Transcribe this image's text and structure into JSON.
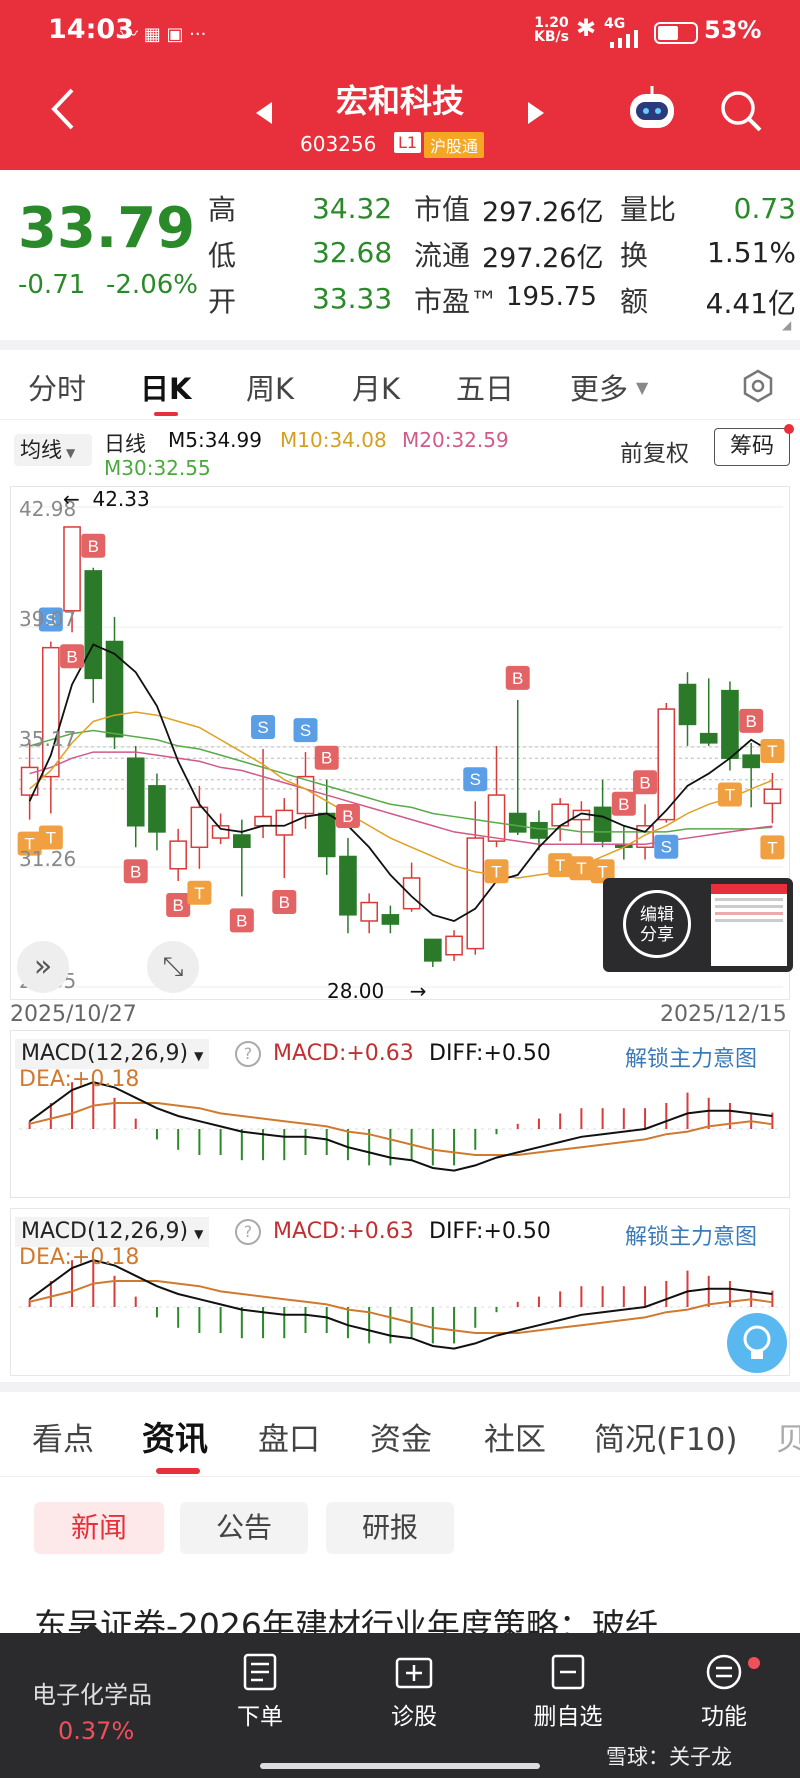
{
  "status_bar": {
    "time": "14:03",
    "speed_top": "1.20",
    "speed_bottom": "KB/s",
    "network": "4G",
    "battery": "53%"
  },
  "header": {
    "title": "宏和科技",
    "code": "603256",
    "level_badge": "L1",
    "exchange_badge": "沪股通"
  },
  "quote": {
    "price": "33.79",
    "change": "-0.71",
    "change_pct": "-2.06%",
    "rows": [
      [
        {
          "label": "高",
          "value": "34.32"
        },
        {
          "label": "市值",
          "value": "297.26亿"
        },
        {
          "label": "量比",
          "value": "0.73"
        }
      ],
      [
        {
          "label": "低",
          "value": "32.68"
        },
        {
          "label": "流通",
          "value": "297.26亿"
        },
        {
          "label": "换",
          "value": "1.51%"
        }
      ],
      [
        {
          "label": "开",
          "value": "33.33"
        },
        {
          "label": "市盈™",
          "value": "195.75"
        },
        {
          "label": "额",
          "value": "4.41亿"
        }
      ]
    ]
  },
  "chart_tabs": [
    "分时",
    "日K",
    "周K",
    "月K",
    "五日",
    "更多"
  ],
  "active_chart_tab": "日K",
  "ma_bar": {
    "select": "均线",
    "period": "日线",
    "m5": "M5:34.99",
    "m10": "M10:34.08",
    "m20": "M20:32.59",
    "m30": "M30:32.55",
    "adjust": "前复权",
    "chips_button": "筹码"
  },
  "kline_labels": {
    "y_ticks": [
      "42.98",
      "39.07",
      "35.17",
      "31.26",
      "27.35"
    ],
    "max_note": "42.33",
    "min_note": "28.00",
    "date_start": "2025/10/27",
    "date_end": "2025/12/15",
    "share_popup": [
      "编辑",
      "分享"
    ]
  },
  "chart_data": {
    "type": "candlestick",
    "ylim": [
      27.35,
      42.98
    ],
    "candles": [
      {
        "o": 33.6,
        "c": 34.5,
        "h": 35.4,
        "l": 32.8
      },
      {
        "o": 34.2,
        "c": 38.4,
        "h": 38.6,
        "l": 33.0
      },
      {
        "o": 39.6,
        "c": 42.33,
        "h": 42.33,
        "l": 38.9
      },
      {
        "o": 40.9,
        "c": 37.4,
        "h": 41.0,
        "l": 36.6
      },
      {
        "o": 38.6,
        "c": 35.5,
        "h": 39.4,
        "l": 35.1
      },
      {
        "o": 34.8,
        "c": 32.6,
        "h": 35.2,
        "l": 31.9
      },
      {
        "o": 33.9,
        "c": 32.4,
        "h": 34.3,
        "l": 31.8
      },
      {
        "o": 31.2,
        "c": 32.1,
        "h": 32.5,
        "l": 30.8
      },
      {
        "o": 31.9,
        "c": 33.2,
        "h": 33.9,
        "l": 31.2
      },
      {
        "o": 32.2,
        "c": 32.6,
        "h": 33.0,
        "l": 32.0
      },
      {
        "o": 32.3,
        "c": 31.9,
        "h": 32.8,
        "l": 30.3
      },
      {
        "o": 32.6,
        "c": 32.9,
        "h": 35.1,
        "l": 32.2
      },
      {
        "o": 32.3,
        "c": 33.1,
        "h": 33.5,
        "l": 30.9
      },
      {
        "o": 33.0,
        "c": 34.2,
        "h": 35.0,
        "l": 32.5
      },
      {
        "o": 33.0,
        "c": 31.6,
        "h": 34.1,
        "l": 31.0
      },
      {
        "o": 31.6,
        "c": 29.7,
        "h": 32.2,
        "l": 29.1
      },
      {
        "o": 29.5,
        "c": 30.1,
        "h": 30.4,
        "l": 29.1
      },
      {
        "o": 29.7,
        "c": 29.4,
        "h": 30.0,
        "l": 29.1
      },
      {
        "o": 29.9,
        "c": 30.9,
        "h": 31.4,
        "l": 29.8
      },
      {
        "o": 28.9,
        "c": 28.2,
        "h": 28.9,
        "l": 28.0
      },
      {
        "o": 28.4,
        "c": 29.0,
        "h": 29.2,
        "l": 28.2
      },
      {
        "o": 28.6,
        "c": 32.2,
        "h": 33.4,
        "l": 28.4
      },
      {
        "o": 32.1,
        "c": 33.6,
        "h": 35.2,
        "l": 31.9
      },
      {
        "o": 33.0,
        "c": 32.4,
        "h": 36.7,
        "l": 32.3
      },
      {
        "o": 32.7,
        "c": 32.2,
        "h": 33.1,
        "l": 31.8
      },
      {
        "o": 32.6,
        "c": 33.3,
        "h": 33.5,
        "l": 32.1
      },
      {
        "o": 32.8,
        "c": 33.1,
        "h": 33.4,
        "l": 32.0
      },
      {
        "o": 33.2,
        "c": 32.1,
        "h": 34.1,
        "l": 31.9
      },
      {
        "o": 32.0,
        "c": 31.9,
        "h": 32.6,
        "l": 31.5
      },
      {
        "o": 31.9,
        "c": 32.6,
        "h": 33.3,
        "l": 31.5
      },
      {
        "o": 32.8,
        "c": 36.4,
        "h": 36.6,
        "l": 32.7
      },
      {
        "o": 37.2,
        "c": 35.9,
        "h": 37.6,
        "l": 35.2
      },
      {
        "o": 35.6,
        "c": 35.3,
        "h": 37.4,
        "l": 35.2
      },
      {
        "o": 37.0,
        "c": 34.8,
        "h": 37.3,
        "l": 34.4
      },
      {
        "o": 34.9,
        "c": 34.5,
        "h": 35.3,
        "l": 33.2
      },
      {
        "o": 33.33,
        "c": 33.79,
        "h": 34.32,
        "l": 32.68
      }
    ],
    "ma5": [
      33.4,
      34.9,
      37.2,
      38.5,
      38.2,
      37.6,
      36.5,
      34.7,
      33.3,
      32.5,
      32.4,
      32.6,
      32.6,
      32.9,
      33.0,
      32.6,
      31.9,
      31.0,
      30.3,
      29.7,
      29.5,
      29.9,
      30.8,
      31.0,
      31.9,
      32.6,
      33.0,
      32.9,
      32.6,
      32.4,
      33.1,
      33.9,
      34.3,
      34.8,
      35.4,
      34.99
    ],
    "ma10": [
      33.8,
      34.4,
      35.3,
      36.0,
      36.2,
      36.3,
      36.2,
      36.0,
      35.8,
      35.4,
      35.0,
      34.6,
      34.1,
      33.8,
      33.4,
      33.0,
      32.6,
      32.2,
      31.9,
      31.6,
      31.3,
      31.1,
      31.0,
      30.9,
      31.0,
      31.1,
      31.3,
      31.6,
      31.9,
      32.3,
      32.6,
      33.0,
      33.3,
      33.5,
      33.8,
      34.08
    ],
    "ma20": [
      34.3,
      34.5,
      34.8,
      35.0,
      35.0,
      35.0,
      34.9,
      34.8,
      34.7,
      34.5,
      34.4,
      34.2,
      34.0,
      33.8,
      33.6,
      33.4,
      33.2,
      33.0,
      32.8,
      32.6,
      32.4,
      32.3,
      32.2,
      32.1,
      32.0,
      32.0,
      32.0,
      32.0,
      32.0,
      32.0,
      32.1,
      32.2,
      32.3,
      32.4,
      32.5,
      32.59
    ],
    "ma30": [
      35.2,
      35.4,
      35.6,
      35.7,
      35.6,
      35.5,
      35.4,
      35.2,
      35.1,
      34.9,
      34.7,
      34.5,
      34.3,
      34.1,
      33.9,
      33.7,
      33.5,
      33.3,
      33.2,
      33.0,
      32.9,
      32.8,
      32.7,
      32.6,
      32.5,
      32.5,
      32.4,
      32.4,
      32.4,
      32.4,
      32.4,
      32.5,
      32.5,
      32.5,
      32.5,
      32.55
    ],
    "signals": [
      {
        "i": 0,
        "t": "T",
        "pos": "below"
      },
      {
        "i": 1,
        "t": "T",
        "pos": "below"
      },
      {
        "i": 1,
        "t": "S",
        "pos": "above"
      },
      {
        "i": 3,
        "t": "B",
        "pos": "above"
      },
      {
        "i": 2,
        "t": "B",
        "pos": "below"
      },
      {
        "i": 5,
        "t": "B",
        "pos": "below"
      },
      {
        "i": 7,
        "t": "B",
        "pos": "below"
      },
      {
        "i": 8,
        "t": "T",
        "pos": "below"
      },
      {
        "i": 10,
        "t": "B",
        "pos": "below"
      },
      {
        "i": 11,
        "t": "S",
        "pos": "above"
      },
      {
        "i": 12,
        "t": "B",
        "pos": "below"
      },
      {
        "i": 13,
        "t": "S",
        "pos": "above"
      },
      {
        "i": 14,
        "t": "B",
        "pos": "above"
      },
      {
        "i": 15,
        "t": "B",
        "pos": "above"
      },
      {
        "i": 21,
        "t": "S",
        "pos": "above"
      },
      {
        "i": 22,
        "t": "T",
        "pos": "below"
      },
      {
        "i": 23,
        "t": "B",
        "pos": "above"
      },
      {
        "i": 25,
        "t": "T",
        "pos": "below"
      },
      {
        "i": 26,
        "t": "T",
        "pos": "below"
      },
      {
        "i": 27,
        "t": "T",
        "pos": "below"
      },
      {
        "i": 28,
        "t": "B",
        "pos": "above"
      },
      {
        "i": 29,
        "t": "B",
        "pos": "above"
      },
      {
        "i": 30,
        "t": "S",
        "pos": "below"
      },
      {
        "i": 33,
        "t": "T",
        "pos": "below"
      },
      {
        "i": 34,
        "t": "B",
        "pos": "above"
      },
      {
        "i": 35,
        "t": "T",
        "pos": "above"
      },
      {
        "i": 35,
        "t": "T",
        "pos": "below"
      }
    ],
    "macd": {
      "diff": [
        0.3,
        0.9,
        1.5,
        1.8,
        1.6,
        1.2,
        0.8,
        0.5,
        0.3,
        0.1,
        -0.1,
        -0.2,
        -0.3,
        -0.3,
        -0.4,
        -0.7,
        -0.9,
        -1.1,
        -1.2,
        -1.5,
        -1.6,
        -1.4,
        -1.1,
        -0.9,
        -0.7,
        -0.5,
        -0.3,
        -0.2,
        -0.1,
        0.0,
        0.3,
        0.6,
        0.7,
        0.7,
        0.6,
        0.5
      ],
      "dea": [
        0.2,
        0.4,
        0.6,
        0.9,
        1.0,
        1.0,
        1.0,
        0.9,
        0.8,
        0.6,
        0.5,
        0.4,
        0.3,
        0.2,
        0.1,
        -0.1,
        -0.2,
        -0.4,
        -0.6,
        -0.8,
        -0.9,
        -1.0,
        -1.0,
        -1.0,
        -0.9,
        -0.8,
        -0.7,
        -0.6,
        -0.5,
        -0.4,
        -0.2,
        -0.1,
        0.1,
        0.2,
        0.3,
        0.18
      ],
      "hist": [
        0.3,
        1.0,
        1.8,
        1.8,
        1.2,
        0.4,
        -0.4,
        -0.8,
        -1.0,
        -1.0,
        -1.2,
        -1.2,
        -1.2,
        -1.0,
        -1.0,
        -1.2,
        -1.4,
        -1.4,
        -1.2,
        -1.4,
        -1.4,
        -0.8,
        -0.2,
        0.2,
        0.4,
        0.6,
        0.8,
        0.8,
        0.8,
        0.8,
        1.0,
        1.4,
        1.2,
        1.0,
        0.6,
        0.63
      ]
    }
  },
  "macd_panel": {
    "title": "MACD(12,26,9)",
    "macd": "MACD:+0.63",
    "diff": "DIFF:+0.50",
    "dea": "DEA:+0.18",
    "unlock": "解锁主力意图"
  },
  "info_tabs": [
    "看点",
    "资讯",
    "盘口",
    "资金",
    "社区",
    "简况(F10)",
    "贝"
  ],
  "active_info_tab": "资讯",
  "sub_tabs": [
    "新闻",
    "公告",
    "研报"
  ],
  "news_headline": "东吴证券-2026年建材行业年度策略：玻纤",
  "bottom_nav": {
    "sector_name": "电子化学品",
    "sector_change": "0.37%",
    "items": [
      "下单",
      "诊股",
      "删自选",
      "功能"
    ],
    "watermark": "雪球：关子龙"
  },
  "colors": {
    "red": "#e8303c",
    "up": "#d93a3a",
    "down": "#2a7a2a",
    "ma5": "#111111",
    "ma10": "#e0a020",
    "ma20": "#d05a8a",
    "ma30": "#5aaa4a"
  }
}
